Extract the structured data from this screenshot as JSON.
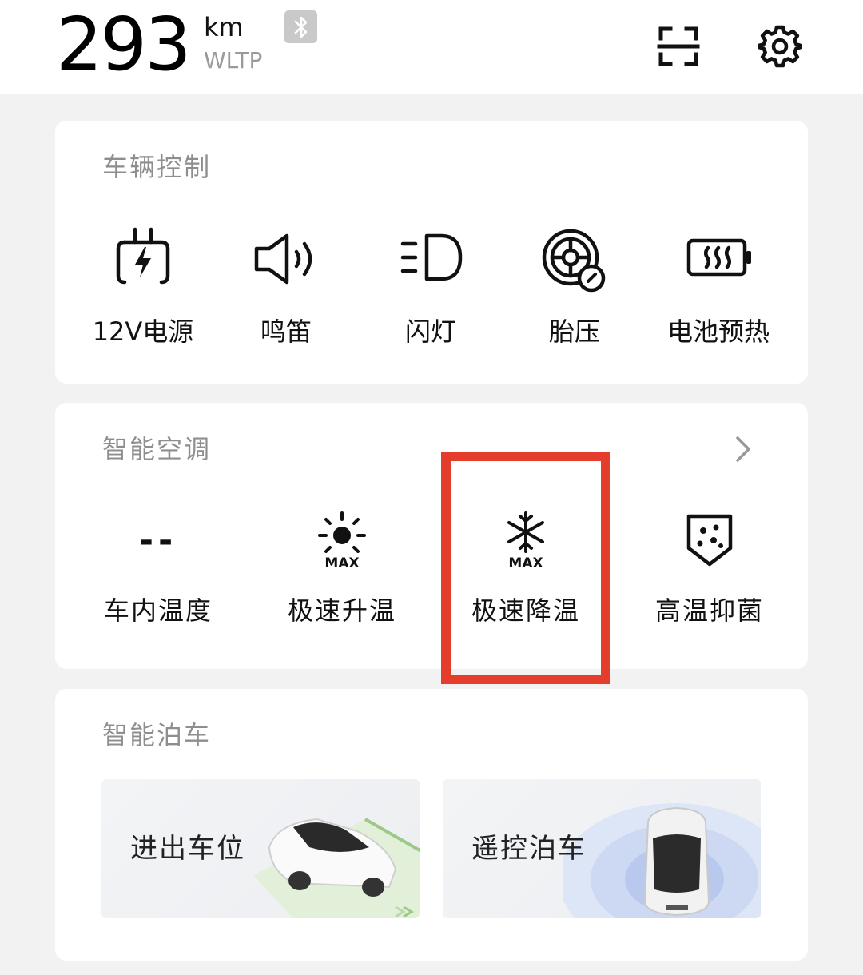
{
  "header": {
    "range_value": "293",
    "range_unit": "km",
    "range_standard": "WLTP",
    "icons": [
      "bluetooth-icon",
      "scan-icon",
      "gear-icon"
    ]
  },
  "vehicle_control": {
    "title": "车辆控制",
    "items": [
      {
        "label": "12V电源",
        "icon": "plug-bolt-icon"
      },
      {
        "label": "鸣笛",
        "icon": "horn-speaker-icon"
      },
      {
        "label": "闪灯",
        "icon": "headlight-icon"
      },
      {
        "label": "胎压",
        "icon": "tire-gauge-icon"
      },
      {
        "label": "电池预热",
        "icon": "battery-heat-icon"
      }
    ]
  },
  "smart_ac": {
    "title": "智能空调",
    "items": [
      {
        "label": "车内温度",
        "value": "--"
      },
      {
        "label": "极速升温",
        "icon": "sun-max-icon",
        "icon_text": "MAX"
      },
      {
        "label": "极速降温",
        "icon": "snowflake-max-icon",
        "icon_text": "MAX"
      },
      {
        "label": "高温抑菌",
        "icon": "shield-dots-icon"
      }
    ],
    "highlight_color": "#e53d2b"
  },
  "smart_parking": {
    "title": "智能泊车",
    "tiles": [
      {
        "label": "进出车位"
      },
      {
        "label": "遥控泊车"
      }
    ]
  }
}
